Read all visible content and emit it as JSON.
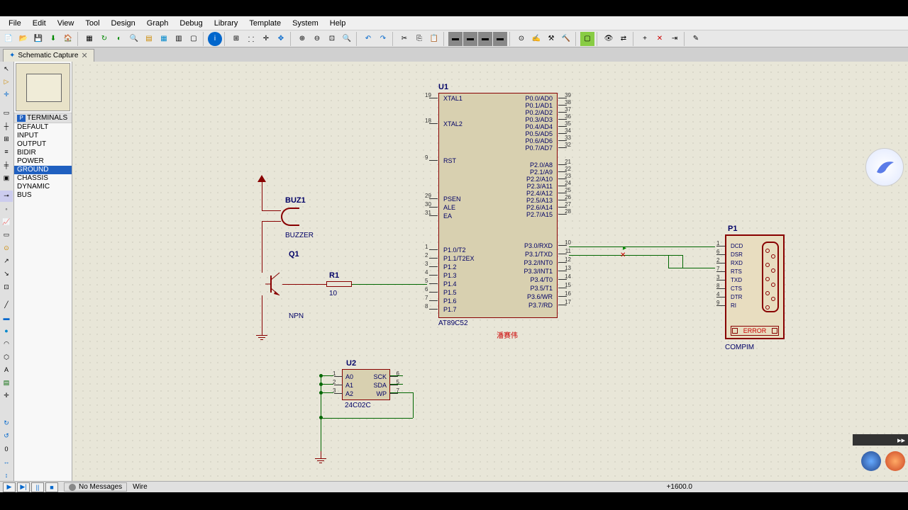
{
  "menu": [
    "File",
    "Edit",
    "View",
    "Tool",
    "Design",
    "Graph",
    "Debug",
    "Library",
    "Template",
    "System",
    "Help"
  ],
  "tab": {
    "title": "Schematic Capture"
  },
  "terminals": {
    "header": "TERMINALS",
    "items": [
      "DEFAULT",
      "INPUT",
      "OUTPUT",
      "BIDIR",
      "POWER",
      "GROUND",
      "CHASSIS",
      "DYNAMIC",
      "BUS"
    ],
    "selected": 5
  },
  "u1": {
    "ref": "U1",
    "value": "AT89C52",
    "left_pins": [
      {
        "num": "19",
        "lbl": "XTAL1"
      },
      {
        "num": "18",
        "lbl": "XTAL2"
      },
      {
        "num": "9",
        "lbl": "RST"
      },
      {
        "num": "29",
        "lbl": "PSEN"
      },
      {
        "num": "30",
        "lbl": "ALE"
      },
      {
        "num": "31",
        "lbl": "EA"
      },
      {
        "num": "1",
        "lbl": "P1.0/T2"
      },
      {
        "num": "2",
        "lbl": "P1.1/T2EX"
      },
      {
        "num": "3",
        "lbl": "P1.2"
      },
      {
        "num": "4",
        "lbl": "P1.3"
      },
      {
        "num": "5",
        "lbl": "P1.4"
      },
      {
        "num": "6",
        "lbl": "P1.5"
      },
      {
        "num": "7",
        "lbl": "P1.6"
      },
      {
        "num": "8",
        "lbl": "P1.7"
      }
    ],
    "right_pins": [
      {
        "num": "39",
        "lbl": "P0.0/AD0"
      },
      {
        "num": "38",
        "lbl": "P0.1/AD1"
      },
      {
        "num": "37",
        "lbl": "P0.2/AD2"
      },
      {
        "num": "36",
        "lbl": "P0.3/AD3"
      },
      {
        "num": "35",
        "lbl": "P0.4/AD4"
      },
      {
        "num": "34",
        "lbl": "P0.5/AD5"
      },
      {
        "num": "33",
        "lbl": "P0.6/AD6"
      },
      {
        "num": "32",
        "lbl": "P0.7/AD7"
      },
      {
        "num": "21",
        "lbl": "P2.0/A8"
      },
      {
        "num": "22",
        "lbl": "P2.1/A9"
      },
      {
        "num": "23",
        "lbl": "P2.2/A10"
      },
      {
        "num": "24",
        "lbl": "P2.3/A11"
      },
      {
        "num": "25",
        "lbl": "P2.4/A12"
      },
      {
        "num": "26",
        "lbl": "P2.5/A13"
      },
      {
        "num": "27",
        "lbl": "P2.6/A14"
      },
      {
        "num": "28",
        "lbl": "P2.7/A15"
      },
      {
        "num": "10",
        "lbl": "P3.0/RXD"
      },
      {
        "num": "11",
        "lbl": "P3.1/TXD"
      },
      {
        "num": "12",
        "lbl": "P3.2/INT0"
      },
      {
        "num": "13",
        "lbl": "P3.3/INT1"
      },
      {
        "num": "14",
        "lbl": "P3.4/T0"
      },
      {
        "num": "15",
        "lbl": "P3.5/T1"
      },
      {
        "num": "16",
        "lbl": "P3.6/WR"
      },
      {
        "num": "17",
        "lbl": "P3.7/RD"
      }
    ],
    "annotation": "潘赛伟"
  },
  "u2": {
    "ref": "U2",
    "value": "24C02C",
    "left_pins": [
      {
        "num": "1",
        "lbl": "A0"
      },
      {
        "num": "2",
        "lbl": "A1"
      },
      {
        "num": "3",
        "lbl": "A2"
      }
    ],
    "right_pins": [
      {
        "num": "6",
        "lbl": "SCK"
      },
      {
        "num": "5",
        "lbl": "SDA"
      },
      {
        "num": "7",
        "lbl": "WP"
      }
    ]
  },
  "buzzer": {
    "ref": "BUZ1",
    "value": "BUZZER"
  },
  "transistor": {
    "ref": "Q1",
    "value": "NPN"
  },
  "resistor": {
    "ref": "R1",
    "value": "10"
  },
  "p1": {
    "ref": "P1",
    "value": "COMPIM",
    "error": "ERROR",
    "pins": [
      {
        "num": "1",
        "lbl": "DCD"
      },
      {
        "num": "6",
        "lbl": "DSR"
      },
      {
        "num": "2",
        "lbl": "RXD"
      },
      {
        "num": "7",
        "lbl": "RTS"
      },
      {
        "num": "3",
        "lbl": "TXD"
      },
      {
        "num": "8",
        "lbl": "CTS"
      },
      {
        "num": "4",
        "lbl": "DTR"
      },
      {
        "num": "9",
        "lbl": "RI"
      }
    ]
  },
  "status": {
    "messages": "No Messages",
    "mode": "Wire",
    "coord": "+1600.0"
  }
}
